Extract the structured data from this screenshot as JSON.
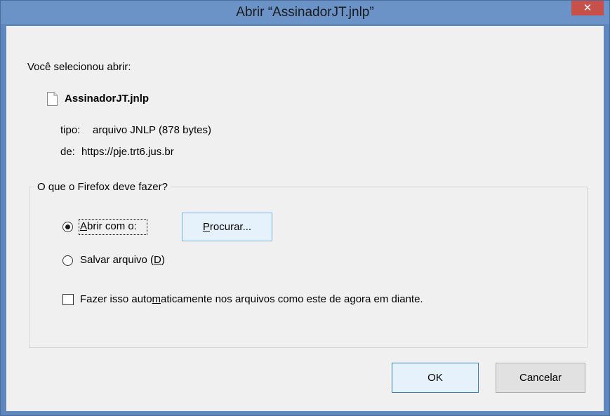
{
  "window": {
    "title": "Abrir “AssinadorJT.jnlp”",
    "close_glyph": "✕"
  },
  "intro": "Você selecionou abrir:",
  "file": {
    "name": "AssinadorJT.jnlp",
    "type_label": "tipo:",
    "type_value": "arquivo JNLP (878 bytes)",
    "from_label": "de:",
    "from_value": "https://pje.trt6.jus.br"
  },
  "action_group": {
    "label": "O que o Firefox deve fazer?",
    "open_with": {
      "prefix": "",
      "mnemonic": "A",
      "rest": "brir com o:",
      "selected": true
    },
    "browse_button": {
      "mnemonic": "P",
      "rest": "rocurar..."
    },
    "save_file": {
      "prefix": "Salvar arquivo (",
      "mnemonic": "D",
      "suffix": ")",
      "selected": false
    },
    "auto": {
      "prefix": "Fazer isso auto",
      "mnemonic": "m",
      "suffix": "aticamente nos arquivos como este de agora em diante.",
      "checked": false
    }
  },
  "buttons": {
    "ok": "OK",
    "cancel": "Cancelar"
  },
  "icons": {
    "file": "document-icon",
    "close": "close-icon"
  },
  "colors": {
    "titlebar": "#6b93c8",
    "close": "#c7504a",
    "client": "#f0f0f0"
  }
}
